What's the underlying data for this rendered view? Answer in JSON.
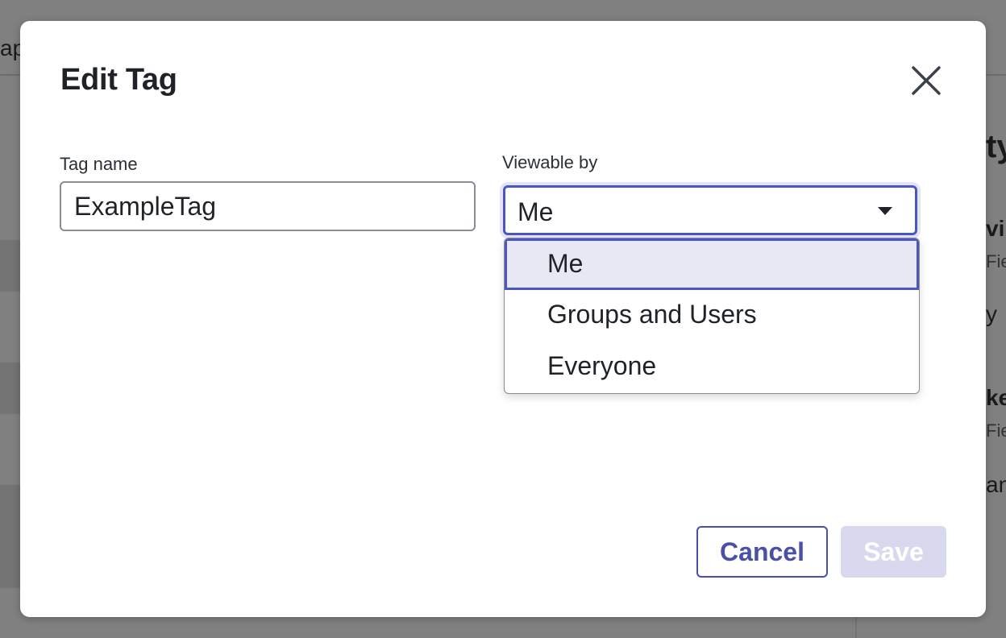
{
  "background": {
    "fragments": [
      "ap",
      "ty",
      "vi",
      "Fie",
      "y",
      "ke",
      "Fie",
      "an"
    ]
  },
  "modal": {
    "title": "Edit Tag",
    "close_icon": "close-icon"
  },
  "form": {
    "tag_name_label": "Tag name",
    "tag_name_value": "ExampleTag",
    "viewable_by_label": "Viewable by",
    "viewable_by_value": "Me",
    "viewable_by_options": [
      "Me",
      "Groups and Users",
      "Everyone"
    ],
    "selected_option_index": 0
  },
  "footer": {
    "cancel_label": "Cancel",
    "save_label": "Save"
  },
  "colors": {
    "accent": "#4a56c2",
    "save_disabled_bg": "#d8d9ee",
    "option_selected_bg": "#e7e8f4"
  }
}
